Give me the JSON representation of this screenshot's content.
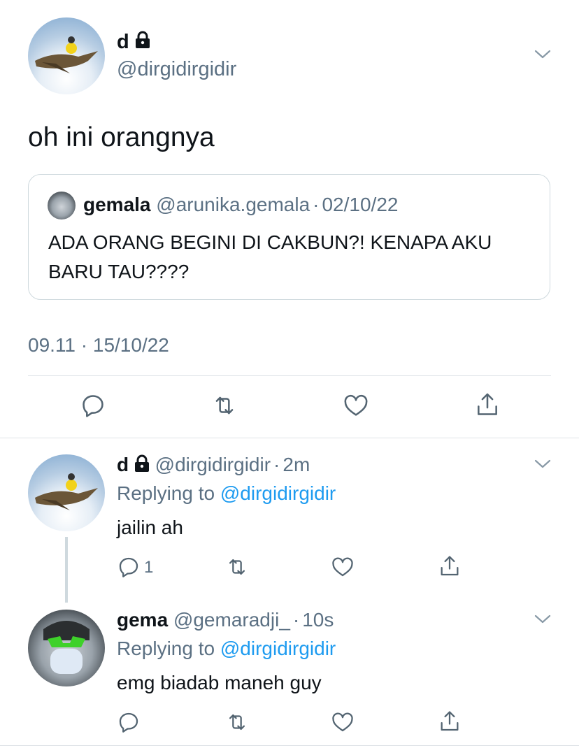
{
  "main_tweet": {
    "display_name": "d",
    "handle": "@dirgidirgidir",
    "text": "oh ini orangnya",
    "timestamp": "09.11 · 15/10/22",
    "quoted": {
      "display_name": "gemala",
      "handle": "@arunika.gemala",
      "separator": "·",
      "date": "02/10/22",
      "text": "ADA ORANG BEGINI DI CAKBUN?! KENAPA AKU BARU TAU????"
    }
  },
  "replies": [
    {
      "display_name": "d",
      "handle": "@dirgidirgidir",
      "separator": "·",
      "time": "2m",
      "replying_prefix": "Replying to",
      "replying_to": "@dirgidirgidir",
      "text": "jailin ah",
      "reply_count": "1"
    },
    {
      "display_name": "gema",
      "handle": "@gemaradji_",
      "separator": "·",
      "time": "10s",
      "replying_prefix": "Replying to",
      "replying_to": "@dirgidirgidir",
      "text": "emg biadab maneh guy",
      "reply_count": ""
    }
  ],
  "icons": {
    "reply": "reply-icon",
    "retweet": "retweet-icon",
    "like": "like-icon",
    "share": "share-icon",
    "chevron": "chevron-down-icon",
    "lock": "lock-icon"
  },
  "colors": {
    "muted": "#5b7083",
    "link": "#1d9bf0",
    "divider": "#dfe3e7"
  }
}
